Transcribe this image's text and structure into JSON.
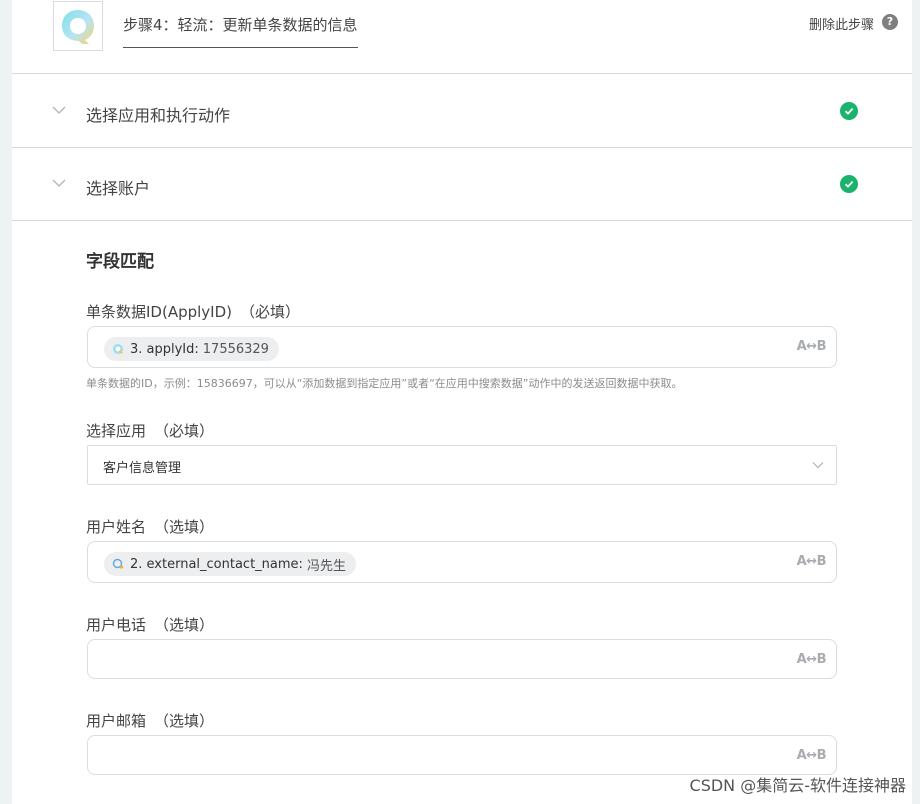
{
  "header": {
    "step_title": "步骤4：轻流：更新单条数据的信息",
    "delete_label": "删除此步骤",
    "help_glyph": "?"
  },
  "sections": [
    {
      "label": "选择应用和执行动作",
      "status": "complete"
    },
    {
      "label": "选择账户",
      "status": "complete"
    }
  ],
  "field_mapping": {
    "title": "字段匹配",
    "fields": [
      {
        "label": "单条数据ID(ApplyID)",
        "requirement": "（必填）",
        "token": {
          "name": "3. applyId:",
          "value": "17556329",
          "icon": "qingflow-logo-icon"
        },
        "hint": "单条数据的ID，示例：15836697，可以从“添加数据到指定应用”或者“在应用中搜索数据”动作中的发送返回数据中获取。",
        "mode_icon": "A↔B"
      },
      {
        "label": "选择应用",
        "requirement": "（必填）",
        "selected": "客户信息管理"
      },
      {
        "label": "用户姓名",
        "requirement": "（选填）",
        "token": {
          "name": "2. external_contact_name:",
          "value": "冯先生",
          "icon": "wecom-logo-icon"
        },
        "mode_icon": "A↔B"
      },
      {
        "label": "用户电话",
        "requirement": "（选填）",
        "value": "",
        "mode_icon": "A↔B"
      },
      {
        "label": "用户邮箱",
        "requirement": "（选填）",
        "value": "",
        "mode_icon": "A↔B"
      }
    ]
  },
  "watermark": "CSDN @集简云-软件连接神器",
  "colors": {
    "success": "#19b36b",
    "border": "#d9dde0",
    "background": "#eef2f3"
  }
}
